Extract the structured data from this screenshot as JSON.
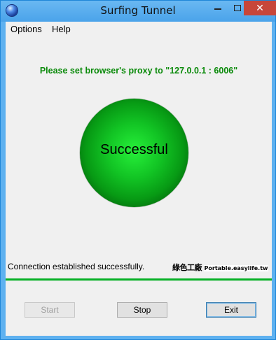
{
  "window": {
    "title": "Surfing Tunnel",
    "close_glyph": "✕"
  },
  "menu": {
    "items": [
      {
        "label": "Options"
      },
      {
        "label": "Help"
      }
    ]
  },
  "main": {
    "proxy_message": "Please set browser's proxy to \"127.0.0.1 : 6006\"",
    "status_indicator": {
      "label": "Successful",
      "color": "#0bbf1f"
    },
    "status_line": "Connection established successfully.",
    "watermark": {
      "cjk_text": "綠色工廠",
      "latin_text": "Portable.easylife.tw"
    },
    "progress": {
      "percent": 100,
      "color": "#06b025"
    }
  },
  "buttons": {
    "start": {
      "label": "Start",
      "enabled": false
    },
    "stop": {
      "label": "Stop",
      "enabled": true
    },
    "exit": {
      "label": "Exit",
      "enabled": true,
      "focused": true
    }
  },
  "colors": {
    "titlebar": "#5eb1f0",
    "close_button": "#c7463a",
    "proxy_text": "#0a8a0a"
  },
  "icons": {
    "app": "globe-icon",
    "minimize": "minimize-icon",
    "maximize": "maximize-icon",
    "close": "close-icon"
  }
}
